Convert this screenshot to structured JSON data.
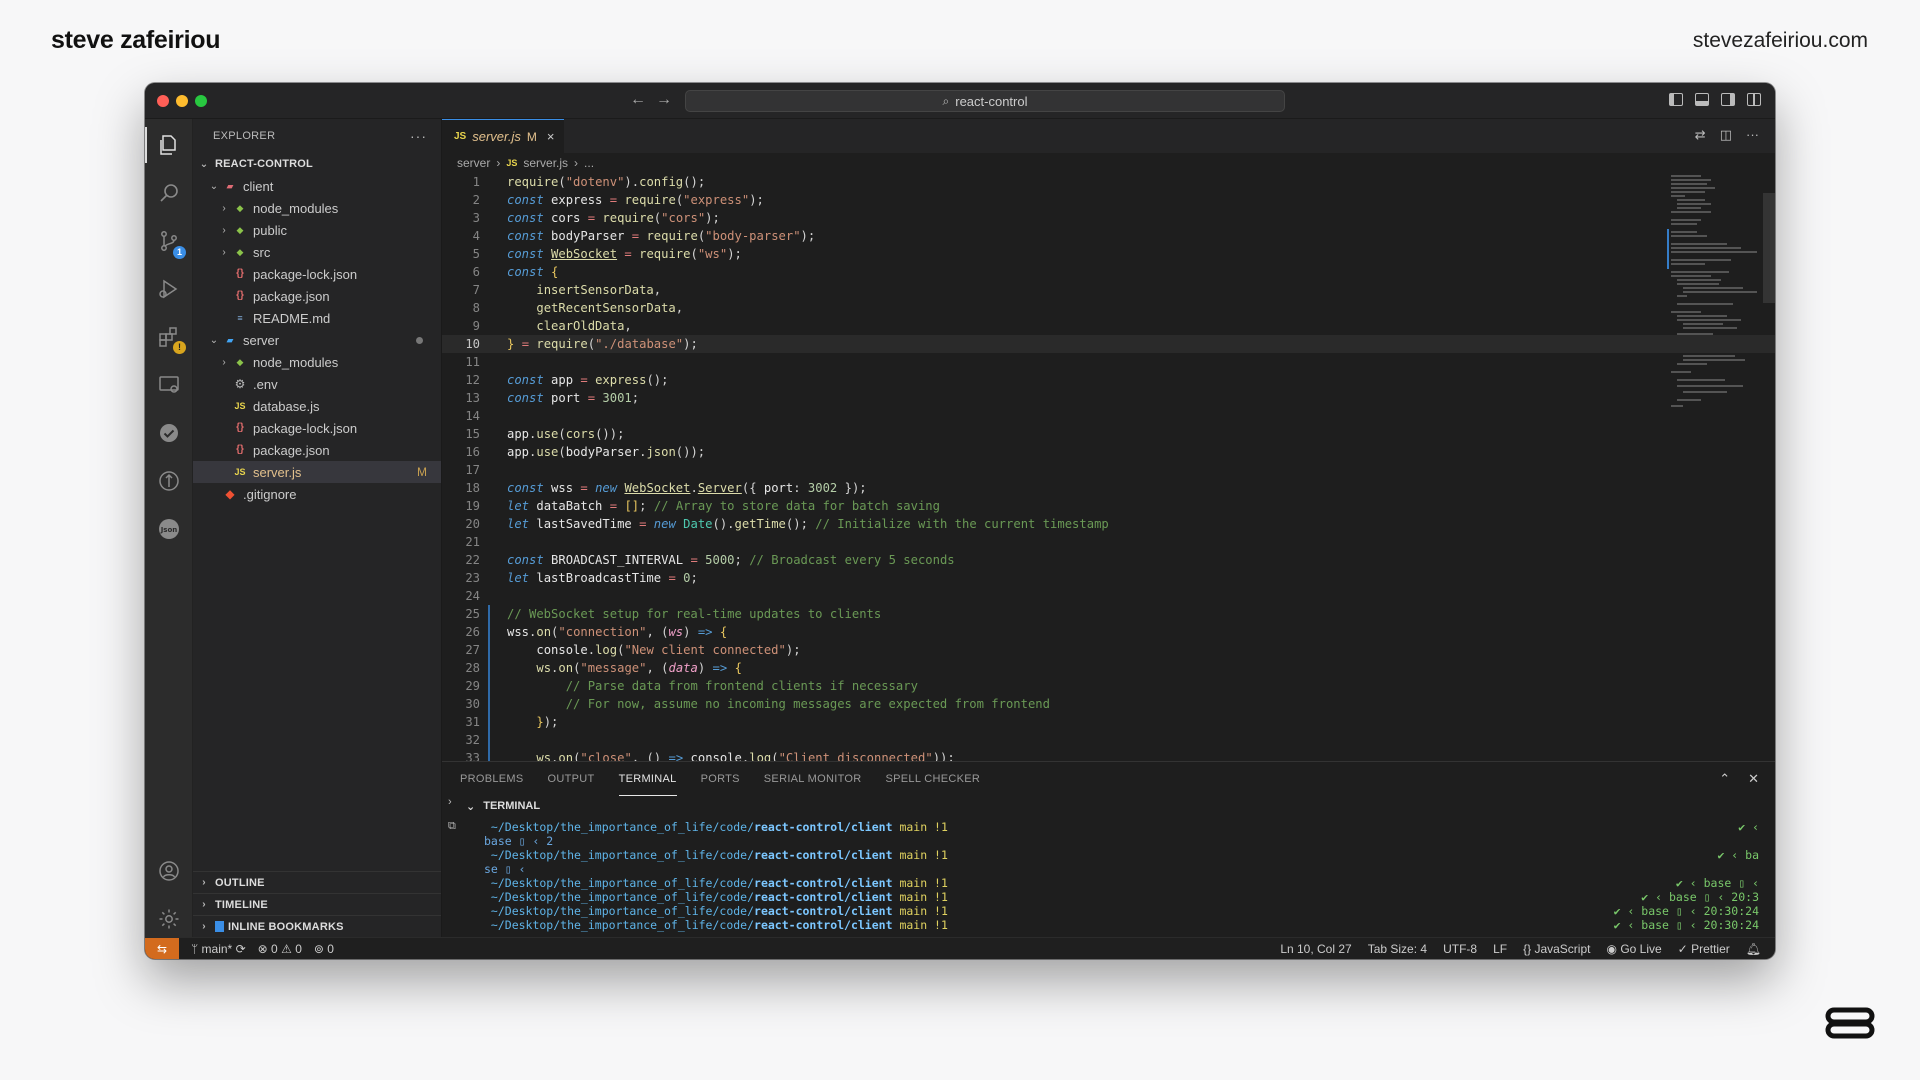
{
  "brand": {
    "left": "steve zafeiriou",
    "right": "stevezafeiriou.com"
  },
  "titlebar": {
    "search": "react-control"
  },
  "activity": {
    "scm_badge": "1"
  },
  "explorer": {
    "header": "EXPLORER",
    "root": "REACT-CONTROL",
    "items": [
      {
        "label": "client",
        "kind": "folder-client",
        "depth": 1,
        "open": true
      },
      {
        "label": "node_modules",
        "kind": "node",
        "depth": 2,
        "open": false
      },
      {
        "label": "public",
        "kind": "node",
        "depth": 2,
        "open": false
      },
      {
        "label": "src",
        "kind": "node",
        "depth": 2,
        "open": false
      },
      {
        "label": "package-lock.json",
        "kind": "json",
        "depth": 2
      },
      {
        "label": "package.json",
        "kind": "json",
        "depth": 2
      },
      {
        "label": "README.md",
        "kind": "md",
        "depth": 2
      },
      {
        "label": "server",
        "kind": "folder-server",
        "depth": 1,
        "open": true,
        "dot": true
      },
      {
        "label": "node_modules",
        "kind": "node",
        "depth": 2,
        "open": false
      },
      {
        "label": ".env",
        "kind": "env",
        "depth": 2
      },
      {
        "label": "database.js",
        "kind": "js",
        "depth": 2
      },
      {
        "label": "package-lock.json",
        "kind": "json",
        "depth": 2
      },
      {
        "label": "package.json",
        "kind": "json",
        "depth": 2
      },
      {
        "label": "server.js",
        "kind": "js",
        "depth": 2,
        "selected": true,
        "badge": "M"
      },
      {
        "label": ".gitignore",
        "kind": "git",
        "depth": 1
      }
    ],
    "bottom_sections": [
      "OUTLINE",
      "TIMELINE",
      "INLINE BOOKMARKS"
    ]
  },
  "tab": {
    "label": "server.js",
    "modified": "M",
    "close": "×"
  },
  "breadcrumb": {
    "folder": "server",
    "file": "server.js",
    "more": "..."
  },
  "editor": {
    "current_line": 10,
    "lines": [
      "<span class=\"fn\">require</span>(<span class=\"str\">\"dotenv\"</span>).<span class=\"fn\">config</span>();",
      "<span class=\"kw\">const</span> <span class=\"wh\">express</span> <span class=\"op\">=</span> <span class=\"fn\">require</span>(<span class=\"str\">\"express\"</span>);",
      "<span class=\"kw\">const</span> <span class=\"wh\">cors</span> <span class=\"op\">=</span> <span class=\"fn\">require</span>(<span class=\"str\">\"cors\"</span>);",
      "<span class=\"kw\">const</span> <span class=\"wh\">bodyParser</span> <span class=\"op\">=</span> <span class=\"fn\">require</span>(<span class=\"str\">\"body-parser\"</span>);",
      "<span class=\"kw\">const</span> <span class=\"ul\">WebSocket</span> <span class=\"op\">=</span> <span class=\"fn\">require</span>(<span class=\"str\">\"ws\"</span>);",
      "<span class=\"kw\">const</span> <span class=\"bk\">{</span>",
      "    <span class=\"fn\">insertSensorData</span>,",
      "    <span class=\"fn\">getRecentSensorData</span>,",
      "    <span class=\"fn\">clearOldData</span>,",
      "<span class=\"bk\">}</span> <span class=\"op\">=</span> <span class=\"fn\">require</span>(<span class=\"str\">\"./database\"</span>);",
      "",
      "<span class=\"kw\">const</span> <span class=\"wh\">app</span> <span class=\"op\">=</span> <span class=\"fn\">express</span>();",
      "<span class=\"kw\">const</span> <span class=\"wh\">port</span> <span class=\"op\">=</span> <span class=\"num\">3001</span>;",
      "",
      "<span class=\"wh\">app</span>.<span class=\"fn\">use</span>(<span class=\"fn\">cors</span>());",
      "<span class=\"wh\">app</span>.<span class=\"fn\">use</span>(<span class=\"wh\">bodyParser</span>.<span class=\"fn\">json</span>());",
      "",
      "<span class=\"kw\">const</span> <span class=\"wh\">wss</span> <span class=\"op\">=</span> <span class=\"kw\">new</span> <span class=\"ul\">WebSocket</span>.<span class=\"ul\">Server</span>({ <span class=\"wh\">port</span>: <span class=\"num\">3002</span> });",
      "<span class=\"kw\">let</span> <span class=\"wh\">dataBatch</span> <span class=\"op\">=</span> <span class=\"bk\">[]</span>; <span class=\"cm\">// Array to store data for batch saving</span>",
      "<span class=\"kw\">let</span> <span class=\"wh\">lastSavedTime</span> <span class=\"op\">=</span> <span class=\"kw\">new</span> <span class=\"cls\">Date</span>().<span class=\"fn\">getTime</span>(); <span class=\"cm\">// Initialize with the current timestamp</span>",
      "",
      "<span class=\"kw\">const</span> <span class=\"wh\">BROADCAST_INTERVAL</span> <span class=\"op\">=</span> <span class=\"num\">5000</span>; <span class=\"cm\">// Broadcast every 5 seconds</span>",
      "<span class=\"kw\">let</span> <span class=\"wh\">lastBroadcastTime</span> <span class=\"op\">=</span> <span class=\"num\">0</span>;",
      "",
      "<span class=\"cm\">// WebSocket setup for real-time updates to clients</span>",
      "<span class=\"wh\">wss</span>.<span class=\"fn\">on</span>(<span class=\"str\">\"connection\"</span>, (<span class=\"pm\">ws</span>) <span class=\"kw\">=&gt;</span> <span class=\"bk\">{</span>",
      "    <span class=\"wh\">console</span>.<span class=\"fn\">log</span>(<span class=\"str\">\"New client connected\"</span>);",
      "    <span class=\"fn\">ws</span>.<span class=\"fn\">on</span>(<span class=\"str\">\"message\"</span>, (<span class=\"pm\">data</span>) <span class=\"kw\">=&gt;</span> <span class=\"bk\">{</span>",
      "        <span class=\"cm\">// Parse data from frontend clients if necessary</span>",
      "        <span class=\"cm\">// For now, assume no incoming messages are expected from frontend</span>",
      "    <span class=\"bk\">}</span>);",
      "",
      "    <span class=\"fn\">ws</span>.<span class=\"fn\">on</span>(<span class=\"str\">\"close\"</span>, () <span class=\"kw\">=&gt;</span> <span class=\"wh\">console</span>.<span class=\"fn\">log</span>(<span class=\"str\">\"Client disconnected\"</span>));"
    ]
  },
  "panel": {
    "tabs": [
      "PROBLEMS",
      "OUTPUT",
      "TERMINAL",
      "PORTS",
      "SERIAL MONITOR",
      "SPELL CHECKER"
    ],
    "active_tab": "TERMINAL",
    "terminal_title": "TERMINAL",
    "terminal_lines": [
      {
        "path_pre": " ~/Desktop/the_importance_of_life/code/",
        "path_bold": "react-control/client",
        "branch": " main !1",
        "right": "✔ ‹"
      },
      {
        "plain": "base ▯ ‹ 2",
        "right": ""
      },
      {
        "path_pre": " ~/Desktop/the_importance_of_life/code/",
        "path_bold": "react-control/client",
        "branch": " main !1",
        "right": "✔ ‹ ba"
      },
      {
        "plain": "se ▯ ‹",
        "right": ""
      },
      {
        "path_pre": " ~/Desktop/the_importance_of_life/code/",
        "path_bold": "react-control/client",
        "branch": " main !1",
        "right": "✔ ‹ base ▯ ‹"
      },
      {
        "path_pre": " ~/Desktop/the_importance_of_life/code/",
        "path_bold": "react-control/client",
        "branch": " main !1",
        "right": "✔ ‹ base ▯ ‹ 20:3"
      },
      {
        "path_pre": " ~/Desktop/the_importance_of_life/code/",
        "path_bold": "react-control/client",
        "branch": " main !1",
        "right": "✔ ‹ base ▯ ‹ 20:30:24"
      },
      {
        "path_pre": " ~/Desktop/the_importance_of_life/code/",
        "path_bold": "react-control/client",
        "branch": " main !1",
        "right": "✔ ‹ base ▯ ‹ 20:30:24"
      }
    ]
  },
  "status": {
    "branch": "main*",
    "errors": "0",
    "warnings": "0",
    "ports": "0",
    "position": "Ln 10, Col 27",
    "tab_size": "Tab Size: 4",
    "encoding": "UTF-8",
    "eol": "LF",
    "language": "JavaScript",
    "go_live": "Go Live",
    "prettier": "Prettier"
  }
}
